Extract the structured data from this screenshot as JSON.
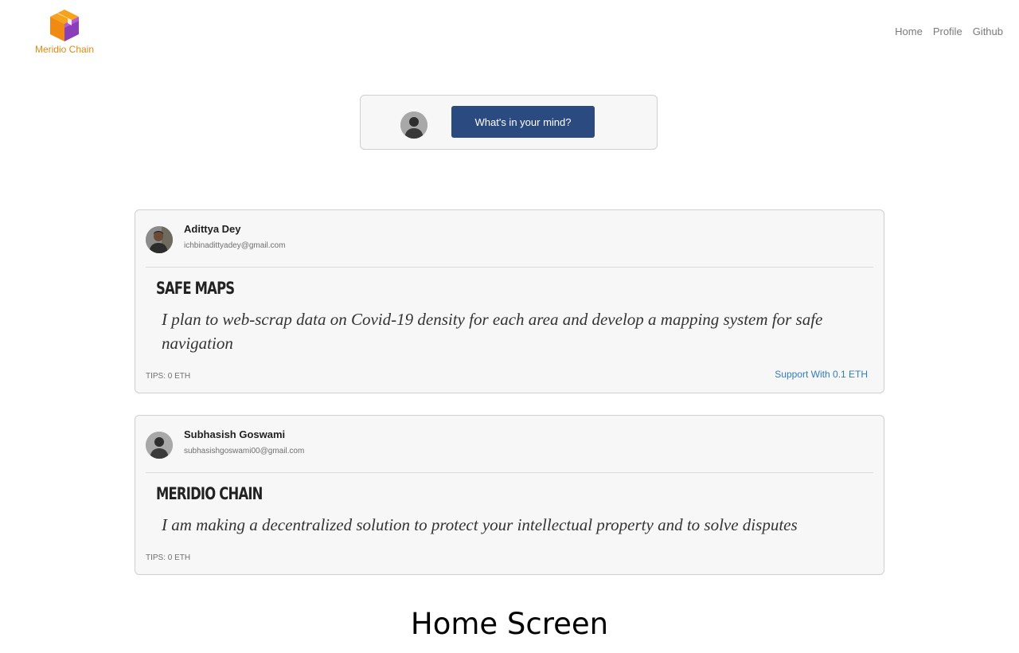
{
  "brand": {
    "name": "Meridio Chain",
    "color": "#e08a10",
    "logo_icon": "cube-icon"
  },
  "nav": {
    "items": [
      "Home",
      "Profile",
      "Github"
    ]
  },
  "composer": {
    "button_label": "What's in your mind?",
    "button_color": "#2b4a80"
  },
  "posts": [
    {
      "author": "Adittya Dey",
      "email": "ichbinadittyadey@gmail.com",
      "title": "Safe Maps",
      "body": "I plan to web-scrap data on Covid-19 density for each area and develop a mapping system for safe navigation",
      "tips": "TIPS: 0 ETH",
      "support_label": "Support With 0.1 ETH"
    },
    {
      "author": "Subhasish Goswami",
      "email": "subhasishgoswami00@gmail.com",
      "title": "Meridio Chain",
      "body": "I am making a decentralized solution to protect your intellectual property and to solve disputes",
      "tips": "TIPS: 0 ETH"
    }
  ],
  "caption": "Home Screen"
}
